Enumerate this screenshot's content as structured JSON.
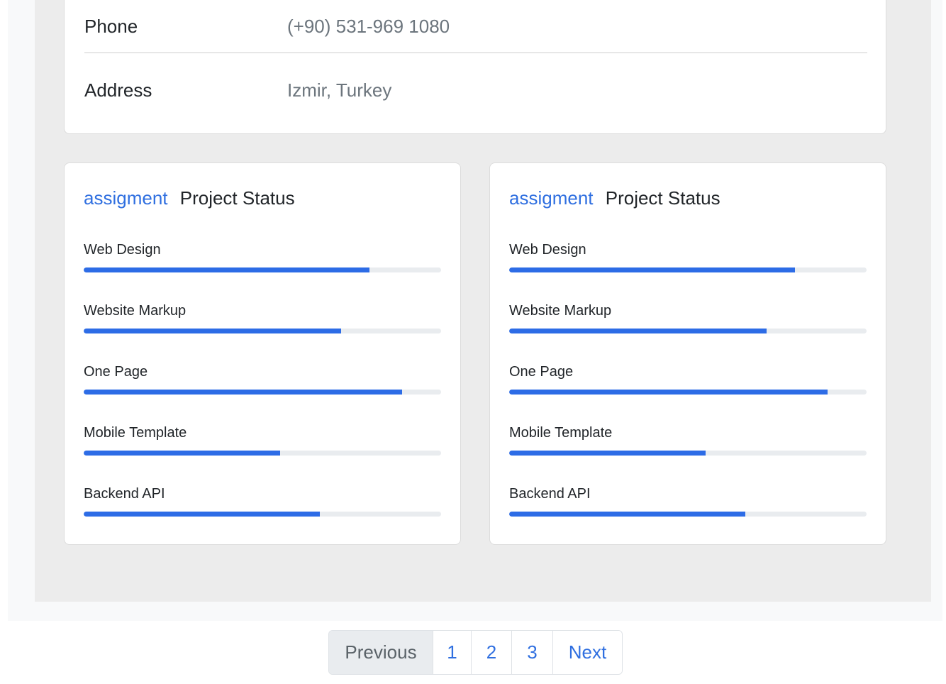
{
  "contact": {
    "phone_label": "Phone",
    "phone_value": "(+90) 531-969 1080",
    "address_label": "Address",
    "address_value": "Izmir, Turkey"
  },
  "project_cards": [
    {
      "tag": "assigment",
      "title": "Project Status",
      "items": [
        {
          "label": "Web Design",
          "progress": 80
        },
        {
          "label": "Website Markup",
          "progress": 72
        },
        {
          "label": "One Page",
          "progress": 89
        },
        {
          "label": "Mobile Template",
          "progress": 55
        },
        {
          "label": "Backend API",
          "progress": 66
        }
      ]
    },
    {
      "tag": "assigment",
      "title": "Project Status",
      "items": [
        {
          "label": "Web Design",
          "progress": 80
        },
        {
          "label": "Website Markup",
          "progress": 72
        },
        {
          "label": "One Page",
          "progress": 89
        },
        {
          "label": "Mobile Template",
          "progress": 55
        },
        {
          "label": "Backend API",
          "progress": 66
        }
      ]
    }
  ],
  "pagination": {
    "previous_label": "Previous",
    "pages": [
      "1",
      "2",
      "3"
    ],
    "next_label": "Next"
  },
  "colors": {
    "accent": "#2d6ce6",
    "track": "#e9ecef",
    "panel_bg": "#ececec"
  }
}
